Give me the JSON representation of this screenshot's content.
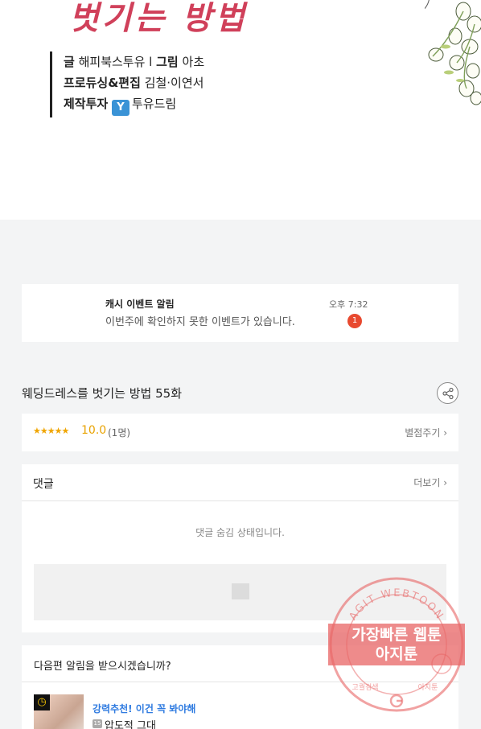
{
  "banner": {
    "title": "벗기는 방법",
    "credits": [
      {
        "label": "글",
        "value": "해피북스투유 l",
        "label2": "그림",
        "value2": "아초"
      },
      {
        "label": "프로듀싱&편집",
        "value": "김철·이연서"
      },
      {
        "label": "제작투자",
        "logo": "Y",
        "value": "투유드림"
      }
    ]
  },
  "notice": {
    "title": "캐시 이벤트 알림",
    "text": "이번주에 확인하지 못한 이벤트가 있습니다.",
    "time": "오후 7:32",
    "badge": "1"
  },
  "episode": {
    "title": "웨딩드레스를 벗기는 방법 55화"
  },
  "rating": {
    "stars": "★★★★★",
    "score": "10.0",
    "count": "(1명)",
    "rate_label": "별점주기 ›",
    "star_value": 10.0
  },
  "comments": {
    "title": "댓글",
    "more_label": "더보기 ›",
    "hidden_message": "댓글 숨김 상태입니다."
  },
  "next_alert": {
    "title": "다음편 알림을 받으시겠습니까?",
    "recommend": "강력추천! 이건 꼭 봐야해",
    "age_badge": "15",
    "work_title": "압도적 그대"
  },
  "watermark": {
    "ring_text": "AGIT WEBTOON",
    "line1": "가장빠른 웹툰",
    "line2": "아지툰",
    "bottom_left": "고퀄검색",
    "bottom_right": "아지툰"
  },
  "colors": {
    "accent_red": "#e8492f",
    "star_orange": "#f0a500",
    "link_blue": "#2f7be0",
    "stamp_red": "#e86464"
  }
}
